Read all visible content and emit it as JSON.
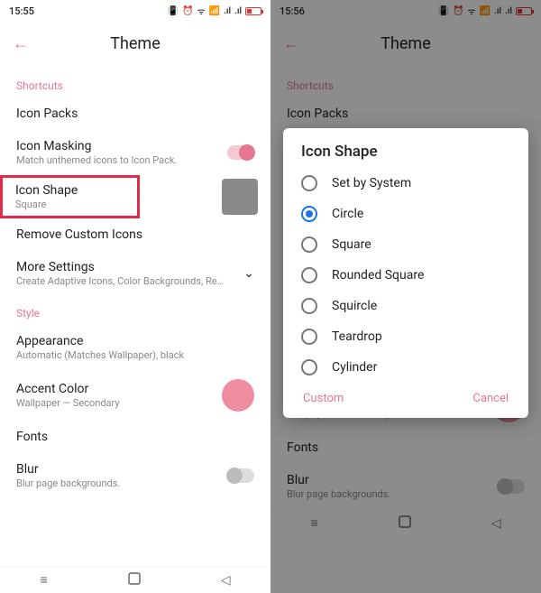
{
  "left": {
    "status": {
      "time": "15:55"
    },
    "header": {
      "title": "Theme"
    },
    "section_shortcuts": "Shortcuts",
    "icon_packs": {
      "label": "Icon Packs"
    },
    "icon_masking": {
      "label": "Icon Masking",
      "sub": "Match unthemed icons to Icon Pack."
    },
    "icon_shape": {
      "label": "Icon Shape",
      "sub": "Square"
    },
    "remove_custom": {
      "label": "Remove Custom Icons"
    },
    "more_settings": {
      "label": "More Settings",
      "sub": "Create Adaptive Icons, Color Backgrounds, Repla…"
    },
    "section_style": "Style",
    "appearance": {
      "label": "Appearance",
      "sub": "Automatic (Matches Wallpaper), black"
    },
    "accent": {
      "label": "Accent Color",
      "sub": "Wallpaper — Secondary"
    },
    "fonts": {
      "label": "Fonts"
    },
    "blur": {
      "label": "Blur",
      "sub": "Blur page backgrounds."
    }
  },
  "right": {
    "status": {
      "time": "15:56"
    },
    "header": {
      "title": "Theme"
    },
    "dialog": {
      "title": "Icon Shape",
      "options": [
        "Set by System",
        "Circle",
        "Square",
        "Rounded Square",
        "Squircle",
        "Teardrop",
        "Cylinder"
      ],
      "selected_index": 1,
      "custom": "Custom",
      "cancel": "Cancel"
    }
  }
}
